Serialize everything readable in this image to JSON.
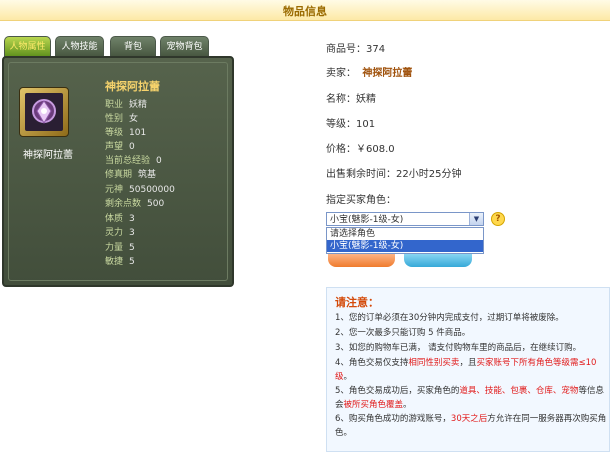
{
  "page_title": "物品信息",
  "tabs": [
    {
      "label": "人物属性",
      "active": true
    },
    {
      "label": "人物技能",
      "active": false
    },
    {
      "label": "背包",
      "active": false
    },
    {
      "label": "宠物背包",
      "active": false
    }
  ],
  "character": {
    "name": "神探阿拉蕾",
    "portrait_name": "神探阿拉蕾",
    "attributes": [
      {
        "key": "职业",
        "value": "妖精"
      },
      {
        "key": "性别",
        "value": "女"
      },
      {
        "key": "等级",
        "value": "101"
      },
      {
        "key": "声望",
        "value": "0"
      },
      {
        "key": "当前总经验",
        "value": "0"
      },
      {
        "key": "修真期",
        "value": "筑基"
      },
      {
        "key": "元神",
        "value": "50500000"
      },
      {
        "key": "剩余点数",
        "value": "500"
      },
      {
        "key": "体质",
        "value": "3"
      },
      {
        "key": "灵力",
        "value": "3"
      },
      {
        "key": "力量",
        "value": "5"
      },
      {
        "key": "敏捷",
        "value": "5"
      }
    ]
  },
  "item": {
    "code_label": "商品号：",
    "code": "374",
    "seller_label": "卖家：",
    "seller": "神探阿拉蕾",
    "name_label": "名称：",
    "name": "妖精",
    "level_label": "等级：",
    "level": "101",
    "price_label": "价格：",
    "price": "￥608.0",
    "remaining_label": "出售剩余时间：",
    "remaining": "22小时25分钟",
    "buyer_label": "指定买家角色："
  },
  "buyer_select": {
    "value": "小宝(魅影-1级-女)",
    "options": [
      "请选择角色",
      "小宝(魅影-1级-女)"
    ]
  },
  "notice": {
    "title": "请注意：",
    "items": [
      {
        "parts": [
          {
            "t": "1、您的订单必须在30分钟内完成支付，过期订单将被废除。"
          }
        ]
      },
      {
        "parts": [
          {
            "t": "2、您一次最多只能订购 5 件商品。"
          }
        ]
      },
      {
        "parts": [
          {
            "t": "3、如您的购物车已满， 请支付购物车里的商品后，在继续订购。"
          }
        ]
      },
      {
        "parts": [
          {
            "t": "4、角色交易仅支持"
          },
          {
            "t": "相同性别买卖",
            "red": true
          },
          {
            "t": "，且"
          },
          {
            "t": "买家账号下所有角色等级需≤10级",
            "red": true
          },
          {
            "t": "。"
          }
        ]
      },
      {
        "parts": [
          {
            "t": "5、角色交易成功后，买家角色的"
          },
          {
            "t": "道具、技能、包裹、仓库、宠物",
            "red": true
          },
          {
            "t": "等信息会"
          },
          {
            "t": "被所买角色覆盖",
            "red": true
          },
          {
            "t": "。"
          }
        ]
      },
      {
        "parts": [
          {
            "t": "6、购买角色成功的游戏账号，"
          },
          {
            "t": "30天之后",
            "red": true
          },
          {
            "t": "方允许在同一服务器再次购买角色。"
          }
        ]
      }
    ]
  },
  "colors": {
    "accent": "#e11b1b",
    "seller": "#a0520c",
    "panel": "#4a5743"
  }
}
